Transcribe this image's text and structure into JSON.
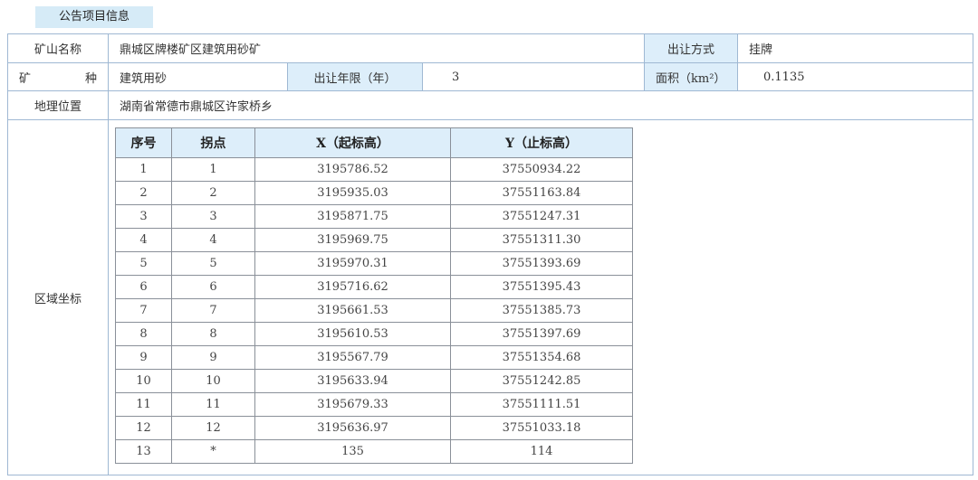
{
  "section_tab": "公告项目信息",
  "fields": {
    "mine_name_label": "矿山名称",
    "mine_name_value": "鼎城区牌楼矿区建筑用砂矿",
    "transfer_method_label": "出让方式",
    "transfer_method_value": "挂牌",
    "mineral_label_a": "矿",
    "mineral_label_b": "种",
    "mineral_value": "建筑用砂",
    "term_label": "出让年限（年）",
    "term_value": "3",
    "area_label": "面积（km²）",
    "area_value": "0.1135",
    "location_label": "地理位置",
    "location_value": "湖南省常德市鼎城区许家桥乡",
    "coords_label": "区域坐标"
  },
  "coords_table": {
    "headers": [
      "序号",
      "拐点",
      "X（起标高）",
      "Y（止标高）"
    ],
    "rows": [
      [
        "1",
        "1",
        "3195786.52",
        "37550934.22"
      ],
      [
        "2",
        "2",
        "3195935.03",
        "37551163.84"
      ],
      [
        "3",
        "3",
        "3195871.75",
        "37551247.31"
      ],
      [
        "4",
        "4",
        "3195969.75",
        "37551311.30"
      ],
      [
        "5",
        "5",
        "3195970.31",
        "37551393.69"
      ],
      [
        "6",
        "6",
        "3195716.62",
        "37551395.43"
      ],
      [
        "7",
        "7",
        "3195661.53",
        "37551385.73"
      ],
      [
        "8",
        "8",
        "3195610.53",
        "37551397.69"
      ],
      [
        "9",
        "9",
        "3195567.79",
        "37551354.68"
      ],
      [
        "10",
        "10",
        "3195633.94",
        "37551242.85"
      ],
      [
        "11",
        "11",
        "3195679.33",
        "37551111.51"
      ],
      [
        "12",
        "12",
        "3195636.97",
        "37551033.18"
      ],
      [
        "13",
        "*",
        "135",
        "114"
      ]
    ]
  }
}
